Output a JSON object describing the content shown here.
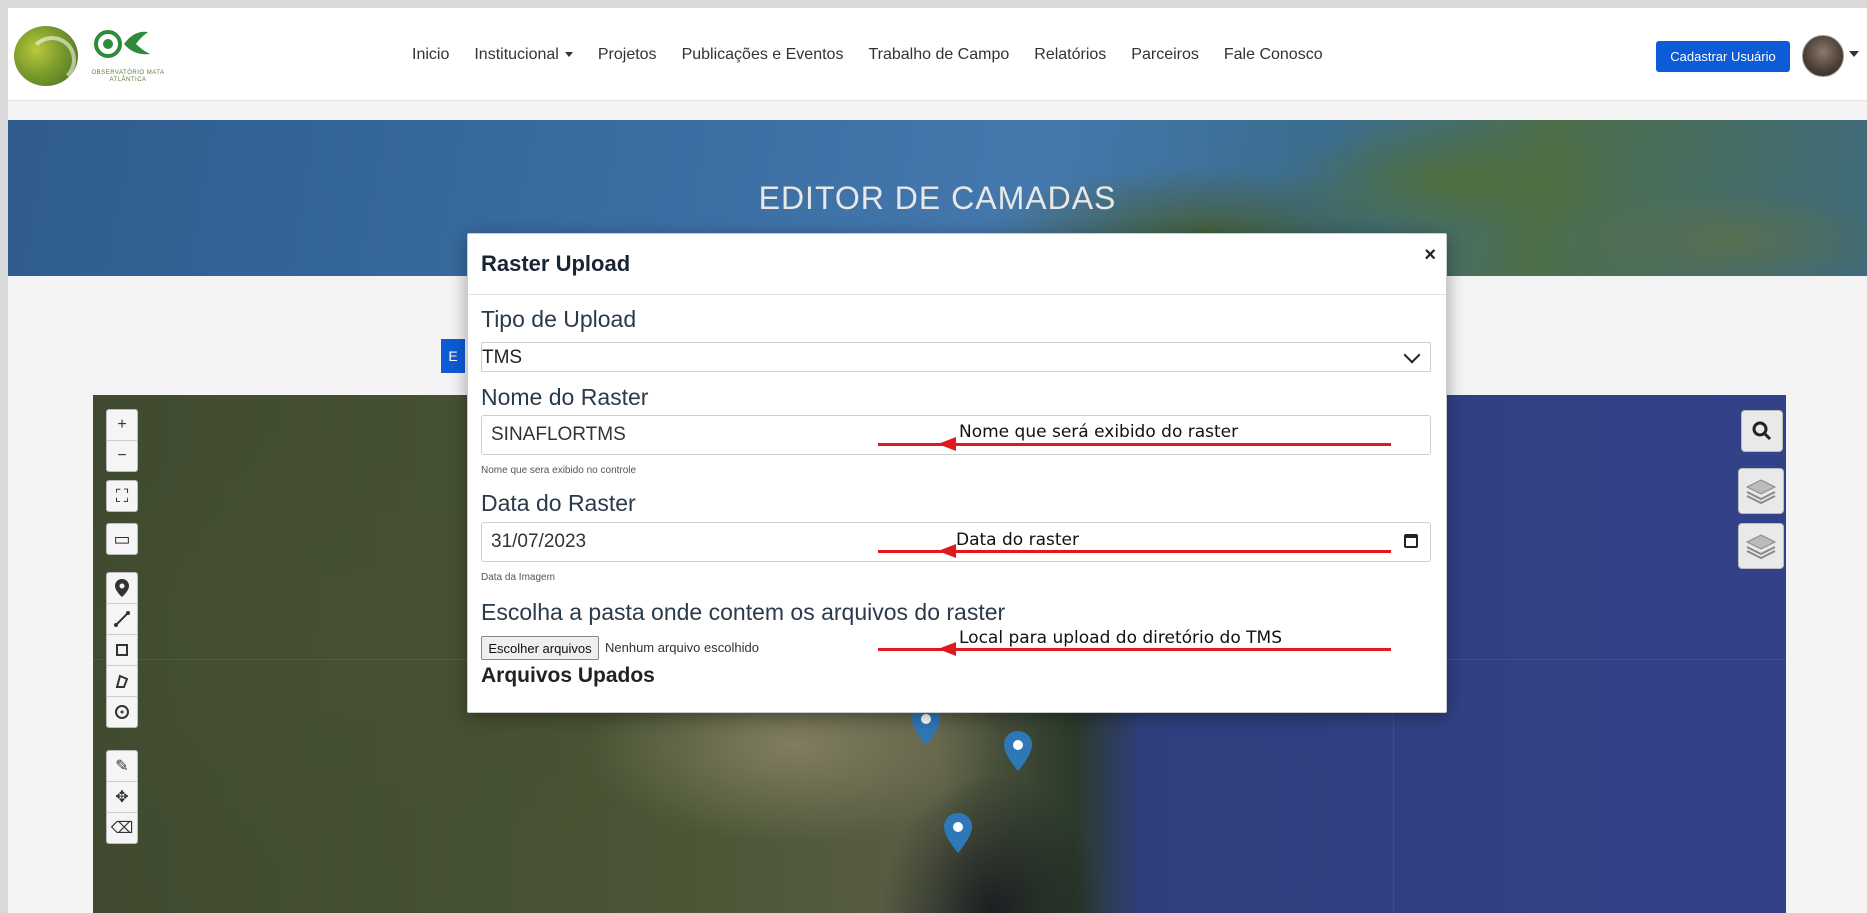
{
  "nav": {
    "logo_text": "OBSERVATÓRIO MATA ATLÂNTICA",
    "links": [
      "Inicio",
      "Institucional",
      "Projetos",
      "Publicações e Eventos",
      "Trabalho de Campo",
      "Relatórios",
      "Parceiros",
      "Fale Conosco"
    ],
    "register_button": "Cadastrar Usuário"
  },
  "banner": {
    "title": "EDITOR DE CAMADAS"
  },
  "page_tab_label": "E",
  "map": {
    "tools_top": [
      "+",
      "−",
      "⛶",
      "▭"
    ],
    "tools_draw": [
      "⬤",
      "⟋",
      "⬚",
      "⬡",
      "◎"
    ],
    "tools_edit": [
      "✎",
      "✥",
      "⌫"
    ],
    "right_buttons": [
      "search-icon",
      "layers-icon",
      "layers-icon"
    ]
  },
  "modal": {
    "title": "Raster Upload",
    "close": "×",
    "upload_type_label": "Tipo de Upload",
    "upload_type_value": "TMS",
    "raster_name_label": "Nome do Raster",
    "raster_name_value": "SINAFLORTMS",
    "raster_name_help": "Nome que sera exibido no controle",
    "raster_date_label": "Data do Raster",
    "raster_date_value": "31/07/2023",
    "raster_date_help": "Data da Imagem",
    "folder_label": "Escolha a pasta onde contem os arquivos do raster",
    "file_button": "Escolher arquivos",
    "file_status": "Nenhum arquivo escolhido",
    "uploaded_heading": "Arquivos Upados"
  },
  "annotations": {
    "name_note": "Nome que será exibido do raster",
    "date_note": "Data do raster",
    "folder_note": "Local para upload do diretório do TMS"
  },
  "colors": {
    "primary": "#0d5bd6",
    "annotation_arrow": "#e0191f",
    "map_pin": "#2e78b8"
  }
}
